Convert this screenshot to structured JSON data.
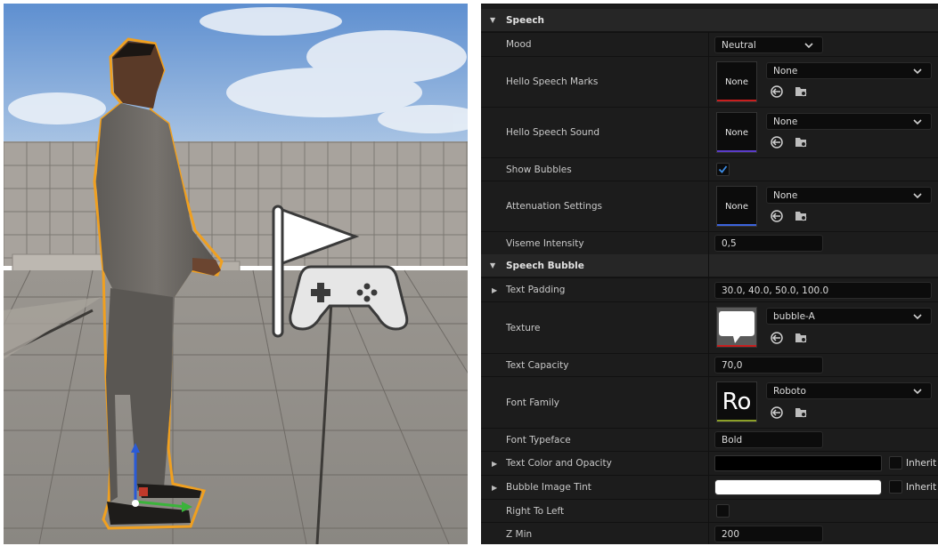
{
  "viewport": {
    "scene": "3d-viewport",
    "sky_color": "#7fa8d8",
    "accent": "#f0a020"
  },
  "details": {
    "sections": [
      {
        "title": "Speech"
      },
      {
        "title": "Speech Bubble"
      }
    ],
    "mood": {
      "label": "Mood",
      "value": "Neutral"
    },
    "hello_speech_marks": {
      "label": "Hello Speech Marks",
      "thumb": "None",
      "asset": "None",
      "bar_color": "#c81e1e"
    },
    "hello_speech_sound": {
      "label": "Hello Speech Sound",
      "thumb": "None",
      "asset": "None",
      "bar_color": "#5a3cc8"
    },
    "show_bubbles": {
      "label": "Show Bubbles",
      "checked": true
    },
    "attenuation_settings": {
      "label": "Attenuation Settings",
      "thumb": "None",
      "asset": "None",
      "bar_color": "#3c64dc"
    },
    "viseme_intensity": {
      "label": "Viseme Intensity",
      "value": "0,5"
    },
    "text_padding": {
      "label": "Text Padding",
      "value": "30.0, 40.0, 50.0, 100.0"
    },
    "texture": {
      "label": "Texture",
      "asset": "bubble-A",
      "bar_color": "#c81e1e"
    },
    "text_capacity": {
      "label": "Text Capacity",
      "value": "70,0"
    },
    "font_family": {
      "label": "Font Family",
      "thumb": "Ro",
      "asset": "Roboto",
      "bar_color": "#8ca028"
    },
    "font_typeface": {
      "label": "Font Typeface",
      "value": "Bold"
    },
    "text_color": {
      "label": "Text Color and Opacity",
      "color": "#000000",
      "inherit": "Inherit"
    },
    "bubble_tint": {
      "label": "Bubble Image Tint",
      "color": "#ffffff",
      "inherit": "Inherit"
    },
    "right_to_left": {
      "label": "Right To Left",
      "checked": false
    },
    "z_min": {
      "label": "Z Min",
      "value": "200"
    }
  }
}
